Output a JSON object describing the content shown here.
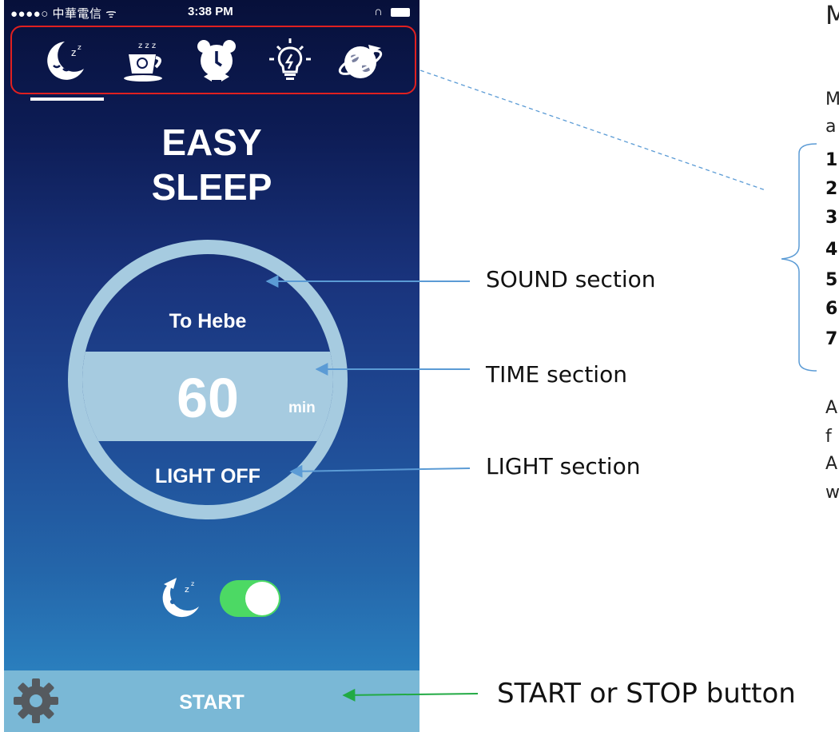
{
  "status_bar": {
    "carrier": "●●●●○ 中華電信 ᯤ",
    "time": "3:38 PM",
    "right": "∩"
  },
  "nav": {
    "tabs": [
      {
        "icon": "moon-sleep-icon"
      },
      {
        "icon": "coffee-cup-icon"
      },
      {
        "icon": "alarm-clock-icon"
      },
      {
        "icon": "light-bulb-icon"
      },
      {
        "icon": "globe-plane-icon"
      }
    ]
  },
  "app": {
    "title_line1": "EASY",
    "title_line2": "SLEEP"
  },
  "dial": {
    "sound_label": "To Hebe",
    "time_value": "60",
    "time_unit": "min",
    "light_label": "LIGHT OFF"
  },
  "toggle": {
    "icon": "sleeping-moon-icon",
    "state": "on",
    "color_on": "#4cd964"
  },
  "bottom_bar": {
    "start_label": "START",
    "settings_icon": "gear-icon"
  },
  "annotations": {
    "sound": "SOUND section",
    "time": "TIME section",
    "light": "LIGHT section",
    "start": "START or STOP button",
    "cut_heading": "M",
    "cut_text_1": "M",
    "cut_text_2": "a",
    "numbers": [
      "1",
      "2",
      "3",
      "4",
      "5",
      "6",
      "7"
    ],
    "cut_text_3": "A",
    "cut_text_4": "f",
    "cut_text_5": "A",
    "cut_text_6": "w"
  },
  "colors": {
    "nav_highlight": "#e02020",
    "dial_ring": "#a6cbe0",
    "arrow_blue": "#5b9bd5",
    "arrow_green": "#22aa44",
    "bottom_bar": "#7ab8d6"
  }
}
